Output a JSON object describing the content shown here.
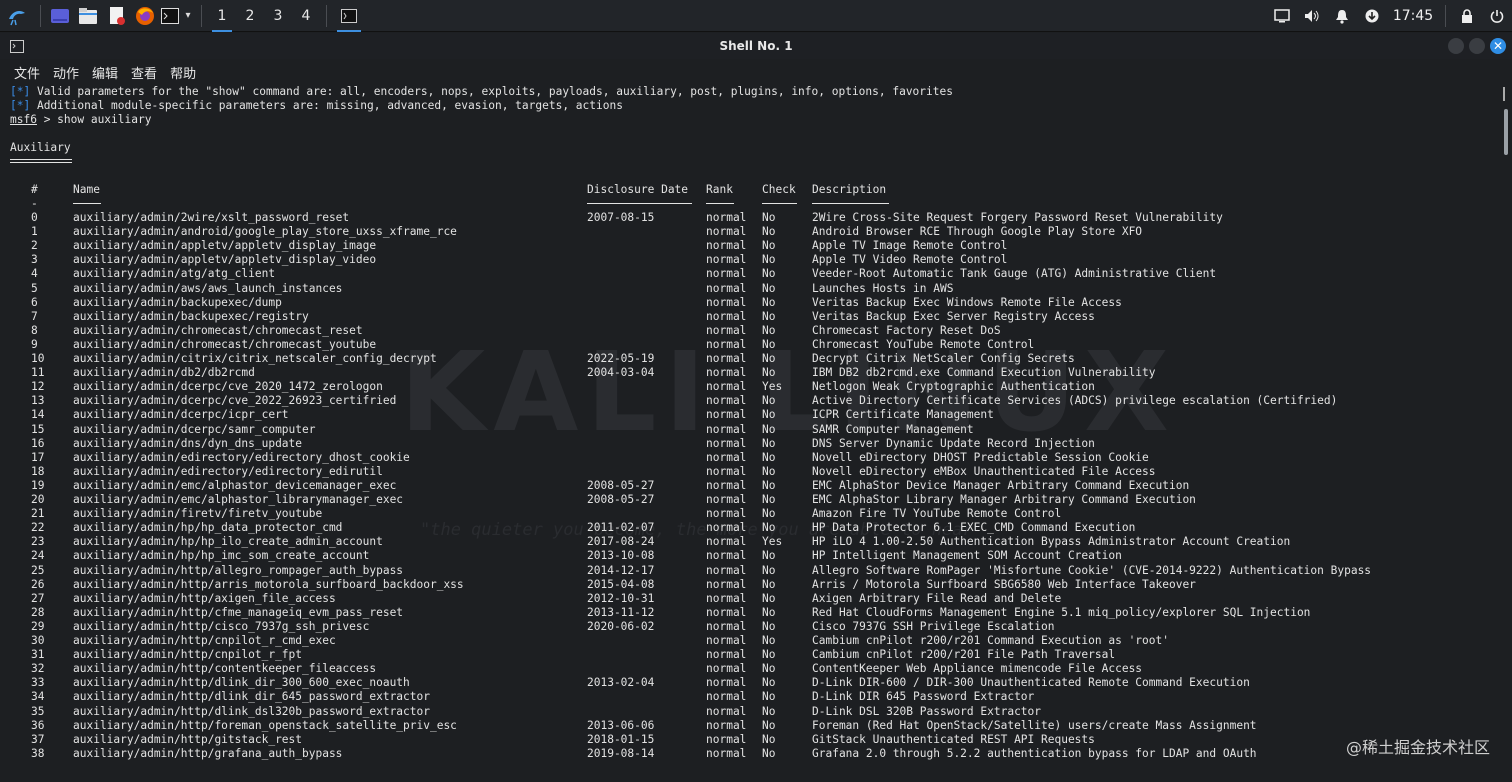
{
  "panel": {
    "workspaces": [
      "1",
      "2",
      "3",
      "4"
    ],
    "clock": "17:45",
    "icons": [
      "kali-menu-icon",
      "desktop-icon",
      "file-manager-icon",
      "text-editor-icon",
      "firefox-icon",
      "terminal-icon"
    ]
  },
  "window": {
    "title": "Shell No. 1",
    "menu": [
      "文件",
      "动作",
      "编辑",
      "查看",
      "帮助"
    ]
  },
  "terminal": {
    "info1_tag": "[*]",
    "info1_text": " Valid parameters for the \"show\" command are: all, encoders, nops, exploits, payloads, auxiliary, post, plugins, info, options, favorites",
    "info2_tag": "[*]",
    "info2_text": " Additional module-specific parameters are: missing, advanced, evasion, targets, actions",
    "prompt": "msf6",
    "command": " > show auxiliary",
    "section_title": "Auxiliary",
    "headers": {
      "num": "#",
      "name": "Name",
      "date": "Disclosure Date",
      "rank": "Rank",
      "check": "Check",
      "desc": "Description"
    },
    "header_underline_num": "-",
    "rows": [
      [
        "0",
        "auxiliary/admin/2wire/xslt_password_reset",
        "2007-08-15",
        "normal",
        "No",
        "2Wire Cross-Site Request Forgery Password Reset Vulnerability"
      ],
      [
        "1",
        "auxiliary/admin/android/google_play_store_uxss_xframe_rce",
        "",
        "normal",
        "No",
        "Android Browser RCE Through Google Play Store XFO"
      ],
      [
        "2",
        "auxiliary/admin/appletv/appletv_display_image",
        "",
        "normal",
        "No",
        "Apple TV Image Remote Control"
      ],
      [
        "3",
        "auxiliary/admin/appletv/appletv_display_video",
        "",
        "normal",
        "No",
        "Apple TV Video Remote Control"
      ],
      [
        "4",
        "auxiliary/admin/atg/atg_client",
        "",
        "normal",
        "No",
        "Veeder-Root Automatic Tank Gauge (ATG) Administrative Client"
      ],
      [
        "5",
        "auxiliary/admin/aws/aws_launch_instances",
        "",
        "normal",
        "No",
        "Launches Hosts in AWS"
      ],
      [
        "6",
        "auxiliary/admin/backupexec/dump",
        "",
        "normal",
        "No",
        "Veritas Backup Exec Windows Remote File Access"
      ],
      [
        "7",
        "auxiliary/admin/backupexec/registry",
        "",
        "normal",
        "No",
        "Veritas Backup Exec Server Registry Access"
      ],
      [
        "8",
        "auxiliary/admin/chromecast/chromecast_reset",
        "",
        "normal",
        "No",
        "Chromecast Factory Reset DoS"
      ],
      [
        "9",
        "auxiliary/admin/chromecast/chromecast_youtube",
        "",
        "normal",
        "No",
        "Chromecast YouTube Remote Control"
      ],
      [
        "10",
        "auxiliary/admin/citrix/citrix_netscaler_config_decrypt",
        "2022-05-19",
        "normal",
        "No",
        "Decrypt Citrix NetScaler Config Secrets"
      ],
      [
        "11",
        "auxiliary/admin/db2/db2rcmd",
        "2004-03-04",
        "normal",
        "No",
        "IBM DB2 db2rcmd.exe Command Execution Vulnerability"
      ],
      [
        "12",
        "auxiliary/admin/dcerpc/cve_2020_1472_zerologon",
        "",
        "normal",
        "Yes",
        "Netlogon Weak Cryptographic Authentication"
      ],
      [
        "13",
        "auxiliary/admin/dcerpc/cve_2022_26923_certifried",
        "",
        "normal",
        "No",
        "Active Directory Certificate Services (ADCS) privilege escalation (Certifried)"
      ],
      [
        "14",
        "auxiliary/admin/dcerpc/icpr_cert",
        "",
        "normal",
        "No",
        "ICPR Certificate Management"
      ],
      [
        "15",
        "auxiliary/admin/dcerpc/samr_computer",
        "",
        "normal",
        "No",
        "SAMR Computer Management"
      ],
      [
        "16",
        "auxiliary/admin/dns/dyn_dns_update",
        "",
        "normal",
        "No",
        "DNS Server Dynamic Update Record Injection"
      ],
      [
        "17",
        "auxiliary/admin/edirectory/edirectory_dhost_cookie",
        "",
        "normal",
        "No",
        "Novell eDirectory DHOST Predictable Session Cookie"
      ],
      [
        "18",
        "auxiliary/admin/edirectory/edirectory_edirutil",
        "",
        "normal",
        "No",
        "Novell eDirectory eMBox Unauthenticated File Access"
      ],
      [
        "19",
        "auxiliary/admin/emc/alphastor_devicemanager_exec",
        "2008-05-27",
        "normal",
        "No",
        "EMC AlphaStor Device Manager Arbitrary Command Execution"
      ],
      [
        "20",
        "auxiliary/admin/emc/alphastor_librarymanager_exec",
        "2008-05-27",
        "normal",
        "No",
        "EMC AlphaStor Library Manager Arbitrary Command Execution"
      ],
      [
        "21",
        "auxiliary/admin/firetv/firetv_youtube",
        "",
        "normal",
        "No",
        "Amazon Fire TV YouTube Remote Control"
      ],
      [
        "22",
        "auxiliary/admin/hp/hp_data_protector_cmd",
        "2011-02-07",
        "normal",
        "No",
        "HP Data Protector 6.1 EXEC_CMD Command Execution"
      ],
      [
        "23",
        "auxiliary/admin/hp/hp_ilo_create_admin_account",
        "2017-08-24",
        "normal",
        "Yes",
        "HP iLO 4 1.00-2.50 Authentication Bypass Administrator Account Creation"
      ],
      [
        "24",
        "auxiliary/admin/hp/hp_imc_som_create_account",
        "2013-10-08",
        "normal",
        "No",
        "HP Intelligent Management SOM Account Creation"
      ],
      [
        "25",
        "auxiliary/admin/http/allegro_rompager_auth_bypass",
        "2014-12-17",
        "normal",
        "No",
        "Allegro Software RomPager 'Misfortune Cookie' (CVE-2014-9222) Authentication Bypass"
      ],
      [
        "26",
        "auxiliary/admin/http/arris_motorola_surfboard_backdoor_xss",
        "2015-04-08",
        "normal",
        "No",
        "Arris / Motorola Surfboard SBG6580 Web Interface Takeover"
      ],
      [
        "27",
        "auxiliary/admin/http/axigen_file_access",
        "2012-10-31",
        "normal",
        "No",
        "Axigen Arbitrary File Read and Delete"
      ],
      [
        "28",
        "auxiliary/admin/http/cfme_manageiq_evm_pass_reset",
        "2013-11-12",
        "normal",
        "No",
        "Red Hat CloudForms Management Engine 5.1 miq_policy/explorer SQL Injection"
      ],
      [
        "29",
        "auxiliary/admin/http/cisco_7937g_ssh_privesc",
        "2020-06-02",
        "normal",
        "No",
        "Cisco 7937G SSH Privilege Escalation"
      ],
      [
        "30",
        "auxiliary/admin/http/cnpilot_r_cmd_exec",
        "",
        "normal",
        "No",
        "Cambium cnPilot r200/r201 Command Execution as 'root'"
      ],
      [
        "31",
        "auxiliary/admin/http/cnpilot_r_fpt",
        "",
        "normal",
        "No",
        "Cambium cnPilot r200/r201 File Path Traversal"
      ],
      [
        "32",
        "auxiliary/admin/http/contentkeeper_fileaccess",
        "",
        "normal",
        "No",
        "ContentKeeper Web Appliance mimencode File Access"
      ],
      [
        "33",
        "auxiliary/admin/http/dlink_dir_300_600_exec_noauth",
        "2013-02-04",
        "normal",
        "No",
        "D-Link DIR-600 / DIR-300 Unauthenticated Remote Command Execution"
      ],
      [
        "34",
        "auxiliary/admin/http/dlink_dir_645_password_extractor",
        "",
        "normal",
        "No",
        "D-Link DIR 645 Password Extractor"
      ],
      [
        "35",
        "auxiliary/admin/http/dlink_dsl320b_password_extractor",
        "",
        "normal",
        "No",
        "D-Link DSL 320B Password Extractor"
      ],
      [
        "36",
        "auxiliary/admin/http/foreman_openstack_satellite_priv_esc",
        "2013-06-06",
        "normal",
        "No",
        "Foreman (Red Hat OpenStack/Satellite) users/create Mass Assignment"
      ],
      [
        "37",
        "auxiliary/admin/http/gitstack_rest",
        "2018-01-15",
        "normal",
        "No",
        "GitStack Unauthenticated REST API Requests"
      ],
      [
        "38",
        "auxiliary/admin/http/grafana_auth_bypass",
        "2019-08-14",
        "normal",
        "No",
        "Grafana 2.0 through 5.2.2 authentication bypass for LDAP and OAuth"
      ]
    ]
  },
  "watermark": {
    "logo": "KALI LINUX",
    "tagline": "\"the quieter you become, the more you are able to hear\""
  },
  "corner_watermark": "@稀土掘金技术社区",
  "colors": {
    "accent": "#3d8fe0",
    "info_tag": "#3b8eea",
    "bg": "#1d1f22"
  }
}
